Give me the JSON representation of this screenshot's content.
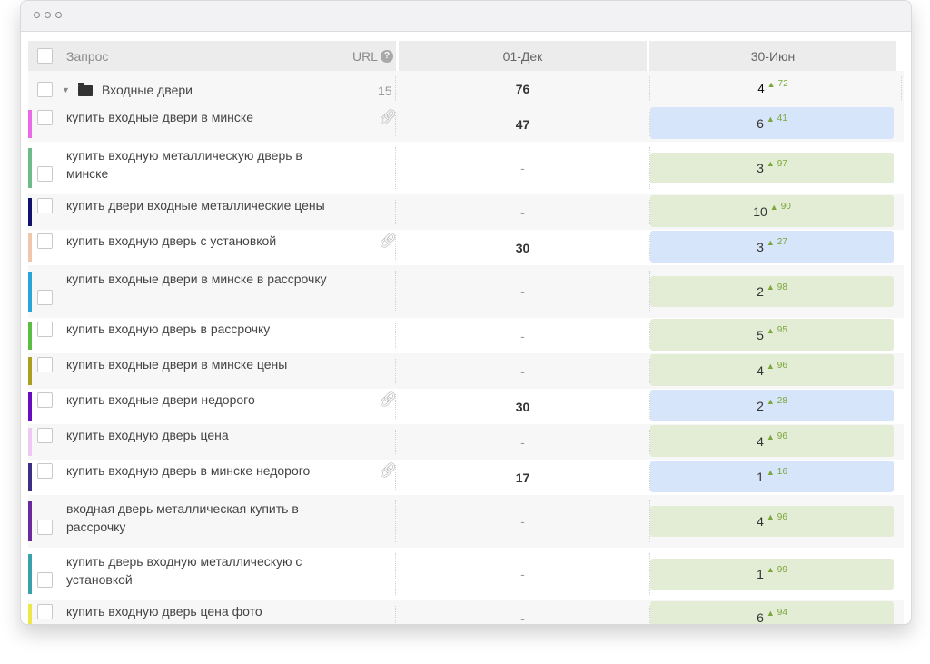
{
  "header": {
    "query_label": "Запрос",
    "url_label": "URL",
    "help_icon": "?",
    "date1": "01-Дек",
    "date2": "30-Июн"
  },
  "group": {
    "name": "Входные двери",
    "count": "15",
    "d1": "76",
    "pos": "4",
    "delta": "72"
  },
  "rows": [
    {
      "keyword": "купить входные двери в минске",
      "color": "#e86ae8",
      "link": true,
      "d1": "47",
      "pos": "6",
      "delta": "41",
      "tone": "blue"
    },
    {
      "keyword": "купить входную металлическую дверь в минске",
      "color": "#6fba8a",
      "link": false,
      "d1": "-",
      "pos": "3",
      "delta": "97",
      "tone": "green"
    },
    {
      "keyword": "купить двери входные металлические цены",
      "color": "#11116e",
      "link": false,
      "d1": "-",
      "pos": "10",
      "delta": "90",
      "tone": "green"
    },
    {
      "keyword": "купить входную дверь с установкой",
      "color": "#f0c6ad",
      "link": true,
      "d1": "30",
      "pos": "3",
      "delta": "27",
      "tone": "blue"
    },
    {
      "keyword": "купить входные двери в минске в рассрочку",
      "color": "#2aa5d8",
      "link": false,
      "d1": "-",
      "pos": "2",
      "delta": "98",
      "tone": "green"
    },
    {
      "keyword": "купить входную дверь в рассрочку",
      "color": "#5cbd44",
      "link": false,
      "d1": "-",
      "pos": "5",
      "delta": "95",
      "tone": "green"
    },
    {
      "keyword": "купить входные двери в минске цены",
      "color": "#a8a01e",
      "link": false,
      "d1": "-",
      "pos": "4",
      "delta": "96",
      "tone": "green"
    },
    {
      "keyword": "купить входные двери недорого",
      "color": "#6a0dc1",
      "link": true,
      "d1": "30",
      "pos": "2",
      "delta": "28",
      "tone": "blue"
    },
    {
      "keyword": "купить входную дверь цена",
      "color": "#ecc8f2",
      "link": false,
      "d1": "-",
      "pos": "4",
      "delta": "96",
      "tone": "green"
    },
    {
      "keyword": "купить входную дверь в минске недорого",
      "color": "#3a2f84",
      "link": true,
      "d1": "17",
      "pos": "1",
      "delta": "16",
      "tone": "blue"
    },
    {
      "keyword": "входная дверь металлическая купить в рассрочку",
      "color": "#6a2a9e",
      "link": false,
      "d1": "-",
      "pos": "4",
      "delta": "96",
      "tone": "green"
    },
    {
      "keyword": "купить дверь входную металлическую с установкой",
      "color": "#3aa1a8",
      "link": false,
      "d1": "-",
      "pos": "1",
      "delta": "99",
      "tone": "green"
    },
    {
      "keyword": "купить входную дверь цена фото",
      "color": "#ece84a",
      "link": false,
      "d1": "-",
      "pos": "6",
      "delta": "94",
      "tone": "green"
    }
  ]
}
